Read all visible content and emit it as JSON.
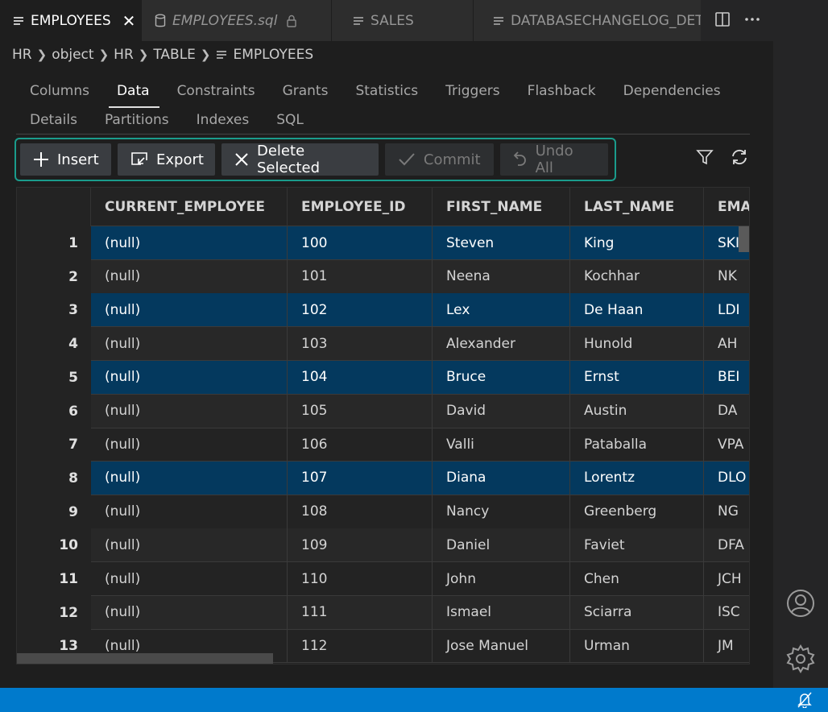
{
  "tabs": [
    {
      "label": "EMPLOYEES",
      "icon": "table-icon",
      "active": true,
      "closable": true
    },
    {
      "label": "EMPLOYEES.sql",
      "icon": "database-icon",
      "italic": true,
      "locked": true
    },
    {
      "label": "SALES",
      "icon": "table-icon"
    },
    {
      "label": "DATABASECHANGELOG_DET",
      "icon": "table-icon"
    }
  ],
  "breadcrumb": [
    "HR",
    "object",
    "HR",
    "TABLE",
    "EMPLOYEES"
  ],
  "subtabs_row1": [
    "Columns",
    "Data",
    "Constraints",
    "Grants",
    "Statistics",
    "Triggers",
    "Flashback",
    "Dependencies"
  ],
  "subtabs_row2": [
    "Details",
    "Partitions",
    "Indexes",
    "SQL"
  ],
  "active_subtab": "Data",
  "toolbar": {
    "insert": "Insert",
    "export": "Export",
    "delete_selected": "Delete Selected",
    "commit": "Commit",
    "undo_all": "Undo All"
  },
  "grid": {
    "columns": [
      "CURRENT_EMPLOYEE",
      "EMPLOYEE_ID",
      "FIRST_NAME",
      "LAST_NAME",
      "EMA"
    ],
    "rows": [
      {
        "n": "1",
        "cells": [
          "(null)",
          "100",
          "Steven",
          "King",
          "SKI"
        ],
        "selected": true
      },
      {
        "n": "2",
        "cells": [
          "(null)",
          "101",
          "Neena",
          "Kochhar",
          "NK"
        ]
      },
      {
        "n": "3",
        "cells": [
          "(null)",
          "102",
          "Lex",
          "De Haan",
          "LDI"
        ],
        "selected": true
      },
      {
        "n": "4",
        "cells": [
          "(null)",
          "103",
          "Alexander",
          "Hunold",
          "AH"
        ]
      },
      {
        "n": "5",
        "cells": [
          "(null)",
          "104",
          "Bruce",
          "Ernst",
          "BEI"
        ],
        "selected": true
      },
      {
        "n": "6",
        "cells": [
          "(null)",
          "105",
          "David",
          "Austin",
          "DA"
        ]
      },
      {
        "n": "7",
        "cells": [
          "(null)",
          "106",
          "Valli",
          "Pataballa",
          "VPA"
        ]
      },
      {
        "n": "8",
        "cells": [
          "(null)",
          "107",
          "Diana",
          "Lorentz",
          "DLO"
        ],
        "selected": true
      },
      {
        "n": "9",
        "cells": [
          "(null)",
          "108",
          "Nancy",
          "Greenberg",
          "NG"
        ]
      },
      {
        "n": "10",
        "cells": [
          "(null)",
          "109",
          "Daniel",
          "Faviet",
          "DFA"
        ]
      },
      {
        "n": "11",
        "cells": [
          "(null)",
          "110",
          "John",
          "Chen",
          "JCH"
        ]
      },
      {
        "n": "12",
        "cells": [
          "(null)",
          "111",
          "Ismael",
          "Sciarra",
          "ISC"
        ]
      },
      {
        "n": "13",
        "cells": [
          "(null)",
          "112",
          "Jose Manuel",
          "Urman",
          "JM"
        ]
      }
    ]
  },
  "colors": {
    "accent": "#1a9c8c",
    "selection": "#04395e",
    "statusbar": "#007acc"
  }
}
